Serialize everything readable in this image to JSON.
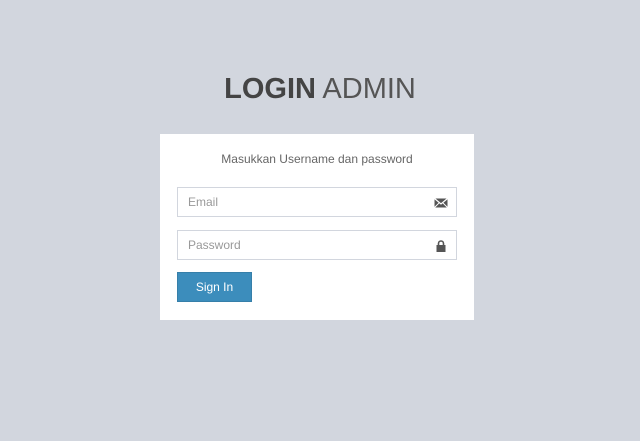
{
  "logo": {
    "bold": "LOGIN",
    "light": " ADMIN"
  },
  "login": {
    "message": "Masukkan Username dan password",
    "email_placeholder": "Email",
    "password_placeholder": "Password",
    "signin_label": "Sign In"
  },
  "icons": {
    "email": "envelope-icon",
    "password": "lock-icon"
  },
  "colors": {
    "background": "#d2d6de",
    "button": "#3c8dbc"
  }
}
